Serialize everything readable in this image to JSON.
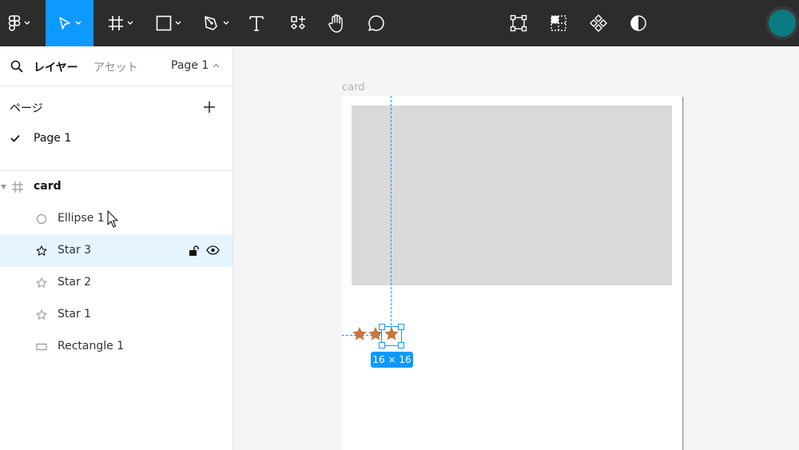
{
  "toolbar": {
    "tools": [
      {
        "name": "main-menu",
        "icon": "figma-logo-icon"
      },
      {
        "name": "move",
        "icon": "cursor-arrow-icon",
        "active": true
      },
      {
        "name": "frame",
        "icon": "frame-hash-icon"
      },
      {
        "name": "shape",
        "icon": "rectangle-icon"
      },
      {
        "name": "pen",
        "icon": "pen-icon"
      },
      {
        "name": "text",
        "icon": "text-icon"
      },
      {
        "name": "resources",
        "icon": "resources-icon"
      },
      {
        "name": "hand",
        "icon": "hand-icon"
      },
      {
        "name": "comment",
        "icon": "comment-icon"
      }
    ],
    "center_actions": [
      {
        "name": "edit-object",
        "icon": "transform-icon"
      },
      {
        "name": "mask",
        "icon": "mask-grid-icon"
      },
      {
        "name": "component",
        "icon": "component-icon"
      },
      {
        "name": "contrast",
        "icon": "half-circle-icon"
      }
    ],
    "accent_color": "#0d99ff",
    "avatar_color": "#0a7b83"
  },
  "panel": {
    "tab_layers": "レイヤー",
    "tab_assets": "アセット",
    "page_selector": "Page 1",
    "pages_title": "ページ",
    "pages": [
      {
        "label": "Page 1",
        "current": true
      }
    ],
    "layers": [
      {
        "label": "card",
        "type": "frame",
        "expanded": true
      },
      {
        "label": "Ellipse 1",
        "type": "ellipse"
      },
      {
        "label": "Star 3",
        "type": "star",
        "selected": true
      },
      {
        "label": "Star 2",
        "type": "star"
      },
      {
        "label": "Star 1",
        "type": "star"
      },
      {
        "label": "Rectangle 1",
        "type": "rectangle"
      }
    ]
  },
  "canvas": {
    "frame_label": "card",
    "size_badge": "16 × 16",
    "star_color": "#c8773a",
    "rect_color": "#d9d9d9"
  }
}
